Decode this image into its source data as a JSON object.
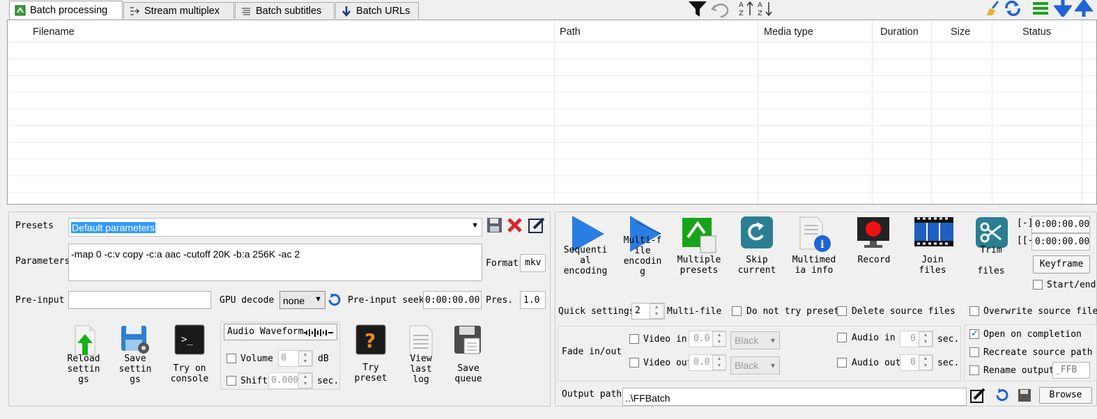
{
  "tabs": [
    {
      "label": "Batch processing",
      "active": true
    },
    {
      "label": "Stream multiplex"
    },
    {
      "label": "Batch subtitles"
    },
    {
      "label": "Batch URLs"
    }
  ],
  "toolbar_icons": [
    "filter-icon",
    "undo-icon",
    "sort-az-icon",
    "sort-za-icon",
    "broom-icon",
    "refresh-icon",
    "list-icon",
    "move-down-icon",
    "move-up-icon"
  ],
  "table": {
    "columns": [
      "Filename",
      "Path",
      "Media type",
      "Duration",
      "Size",
      "Status"
    ]
  },
  "left": {
    "presets_label": "Presets",
    "preset_value": "Default parameters",
    "parameters_label": "Parameters",
    "parameters_value": "-map 0 -c:v copy -c:a aac -cutoff 20K -b:a 256K -ac 2",
    "format_label": "Format",
    "format_value": "mkv",
    "preinput_label": "Pre-input",
    "preinput_value": "",
    "gpu_label": "GPU decode",
    "gpu_value": "none",
    "preinput_seek_label": "Pre-input seeki",
    "preinput_seek_value": "0:00:00.00",
    "pres_label": "Pres. v",
    "pres_value": "1.0",
    "buttons": {
      "reload": "Reload\nsettin\ngs",
      "save": "Save\nsettin\ngs",
      "console": "Try on\nconsole",
      "try_preset": "Try\npreset",
      "view_log": "View\nlast\nlog",
      "save_queue": "Save\nqueue"
    },
    "audio_waveform": "Audio Waveform",
    "volume_label": "Volume",
    "volume_value": "0",
    "volume_unit": "dB",
    "shift_label": "Shift",
    "shift_value": "0.000",
    "shift_unit": "sec."
  },
  "right": {
    "actions": {
      "sequential": "Sequenti\nal\nencoding",
      "multifile": "Multi-f\nile\nencodin\ng",
      "multiple_presets": "Multiple\npresets",
      "skip": "Skip\ncurrent",
      "media_info": "Multimed\nia info",
      "record": "Record",
      "join": "Join\nfiles",
      "trim": "Trim\n\nfiles"
    },
    "trim_start_label": "[-]",
    "trim_start": "0:00:00.00",
    "trim_end_label": "[[-",
    "trim_end": "0:00:00.00",
    "keyframe": "Keyframe",
    "start_end": "Start/end",
    "quick_settings_label": "Quick settings",
    "quick_settings_value": "2",
    "multifile_label": "Multi-file",
    "do_not_try_preset": "Do not try preset",
    "delete_source": "Delete source files",
    "overwrite_source": "Overwrite source file",
    "fade_label": "Fade in/out",
    "video_in": "Video in",
    "video_in_value": "0.0",
    "video_out": "Video out",
    "video_out_value": "0.0",
    "color_in": "Black",
    "color_out": "Black",
    "audio_in": "Audio in",
    "audio_in_value": "0",
    "audio_out": "Audio out",
    "audio_out_value": "0",
    "sec": "sec.",
    "open_on_completion": "Open on completion",
    "open_on_completion_checked": true,
    "recreate_source_path": "Recreate source path",
    "rename_output": "Rename output",
    "rename_suffix": "_FFB",
    "output_path_label": "Output path",
    "output_path_value": "..\\FFBatch",
    "browse": "Browse"
  }
}
